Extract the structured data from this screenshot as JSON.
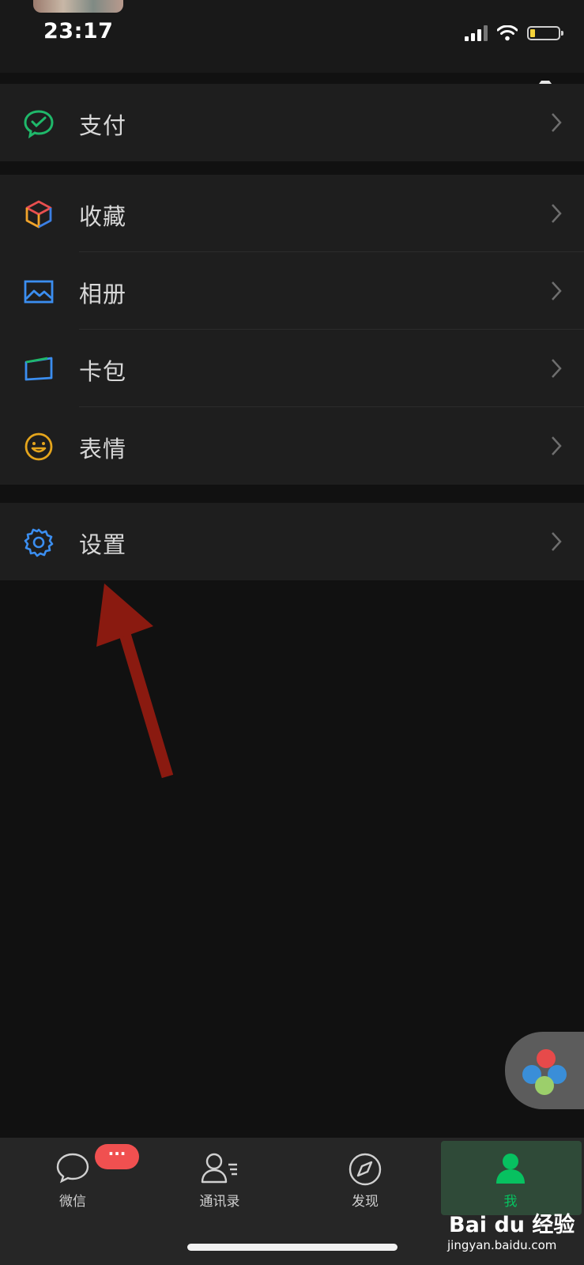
{
  "status_bar": {
    "time": "23:17"
  },
  "groups": [
    {
      "items": [
        {
          "label": "支付",
          "icon": "pay-icon"
        }
      ]
    },
    {
      "items": [
        {
          "label": "收藏",
          "icon": "favorites-icon"
        },
        {
          "label": "相册",
          "icon": "album-icon"
        },
        {
          "label": "卡包",
          "icon": "card-wallet-icon"
        },
        {
          "label": "表情",
          "icon": "sticker-icon"
        }
      ]
    },
    {
      "items": [
        {
          "label": "设置",
          "icon": "settings-icon"
        }
      ]
    }
  ],
  "tabbar": {
    "tabs": [
      {
        "label": "微信",
        "icon": "chat-icon",
        "badge": "···"
      },
      {
        "label": "通讯录",
        "icon": "contacts-icon"
      },
      {
        "label": "发现",
        "icon": "discover-icon"
      },
      {
        "label": "我",
        "icon": "me-icon",
        "active": true
      }
    ]
  },
  "watermark": {
    "brand": "Bai du 经验",
    "url": "jingyan.baidu.com"
  },
  "colors": {
    "accent": "#07c160",
    "badge": "#f05050",
    "annotation_arrow": "#8a1a10"
  }
}
